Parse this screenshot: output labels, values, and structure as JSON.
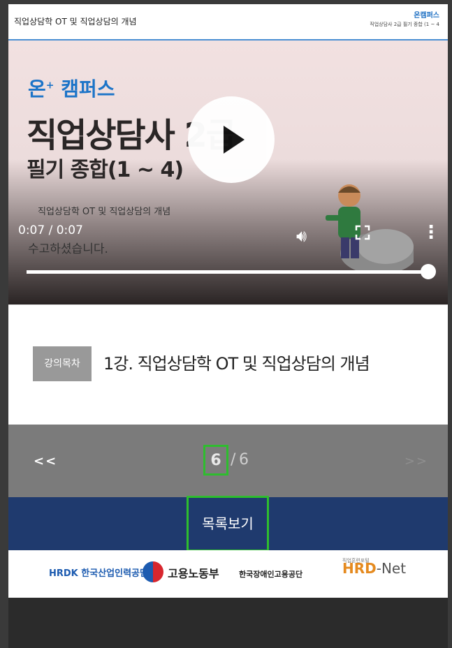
{
  "header": {
    "lecture_title": "직업상담학 OT 및 직업상담의 개념",
    "brand_small": "온캠퍼스",
    "course_small": "직업상담사 2급 필기 종합 (1 ~ 4"
  },
  "video": {
    "brand": "온",
    "brand_sup": "+",
    "brand_rest": " 캠퍼스",
    "course_title": "직업상담사 2급",
    "course_subtitle": "필기 종합(1 ~ 4)",
    "lesson_small": "직업상담학 OT 및 직업상담의 개념",
    "time": "0:07 / 0:07",
    "message": "수고하셨습니다.",
    "progress": 1.0
  },
  "lesson": {
    "toc_label": "강의목차",
    "title": "1강. 직업상담학 OT 및 직업상담의 개념"
  },
  "pager": {
    "prev": "<<",
    "next": ">>",
    "current": "6",
    "sep": "/",
    "total": "6"
  },
  "list_button": "목록보기",
  "footer": {
    "hrdk": "HRDK 한국산업인력공단",
    "moel": "고용노동부",
    "kead": "한국장애인고용공단",
    "hrdnet_top": "직업훈련포털",
    "hrdnet_a": "HRD",
    "hrdnet_b": "-Net"
  },
  "colors": {
    "accent_blue": "#1c74c8",
    "navy": "#1f3a6e",
    "highlight_green": "#2ebd2e"
  }
}
